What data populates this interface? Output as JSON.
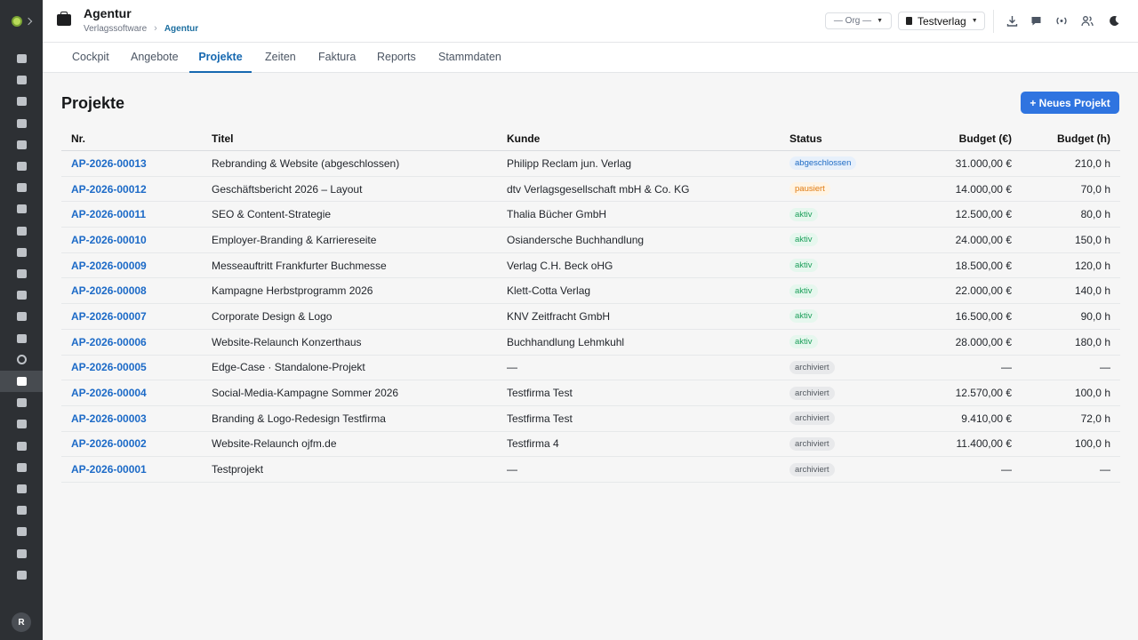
{
  "sidebar": {
    "avatar_initial": "R",
    "icons": [
      "dashboard-icon",
      "calendar-icon",
      "layout-icon",
      "user-edit-icon",
      "inbox-icon",
      "send-icon",
      "lightbulb-icon",
      "library-icon",
      "image-icon",
      "briefcase-icon",
      "newspaper-icon",
      "book-icon",
      "feather-icon",
      "tray-icon",
      "circle-icon",
      "agency-icon",
      "megaphone-icon",
      "film-icon",
      "music-icon",
      "file-icon",
      "store-icon",
      "chat-icon",
      "chart-icon",
      "document-icon",
      "shield-icon"
    ],
    "active_index": 15
  },
  "header": {
    "title": "Agentur",
    "breadcrumb": [
      "Verlagssoftware",
      "Agentur"
    ],
    "org_select": "— Org —",
    "publisher_select": "Testverlag",
    "icons": [
      "download-icon",
      "chat-icon",
      "broadcast-icon",
      "users-icon",
      "moon-icon"
    ]
  },
  "tabs": [
    {
      "label": "Cockpit"
    },
    {
      "label": "Angebote"
    },
    {
      "label": "Projekte",
      "active": true
    },
    {
      "label": "Zeiten"
    },
    {
      "label": "Faktura"
    },
    {
      "label": "Reports"
    },
    {
      "label": "Stammdaten"
    }
  ],
  "main": {
    "title": "Projekte",
    "new_button": "+ Neues Projekt",
    "columns": {
      "nr": "Nr.",
      "titel": "Titel",
      "kunde": "Kunde",
      "status": "Status",
      "budget": "Budget (€)",
      "hours": "Budget (h)"
    },
    "rows": [
      {
        "nr": "AP-2026-00013",
        "titel": "Rebranding & Website (abgeschlossen)",
        "kunde": "Philipp Reclam jun. Verlag",
        "status": "abgeschlossen",
        "budget": "31.000,00 €",
        "hours": "210,0 h"
      },
      {
        "nr": "AP-2026-00012",
        "titel": "Geschäftsbericht 2026 – Layout",
        "kunde": "dtv Verlagsgesellschaft mbH & Co. KG",
        "status": "pausiert",
        "budget": "14.000,00 €",
        "hours": "70,0 h"
      },
      {
        "nr": "AP-2026-00011",
        "titel": "SEO & Content-Strategie",
        "kunde": "Thalia Bücher GmbH",
        "status": "aktiv",
        "budget": "12.500,00 €",
        "hours": "80,0 h"
      },
      {
        "nr": "AP-2026-00010",
        "titel": "Employer-Branding & Karriereseite",
        "kunde": "Osiandersche Buchhandlung",
        "status": "aktiv",
        "budget": "24.000,00 €",
        "hours": "150,0 h"
      },
      {
        "nr": "AP-2026-00009",
        "titel": "Messeauftritt Frankfurter Buchmesse",
        "kunde": "Verlag C.H. Beck oHG",
        "status": "aktiv",
        "budget": "18.500,00 €",
        "hours": "120,0 h"
      },
      {
        "nr": "AP-2026-00008",
        "titel": "Kampagne Herbstprogramm 2026",
        "kunde": "Klett-Cotta Verlag",
        "status": "aktiv",
        "budget": "22.000,00 €",
        "hours": "140,0 h"
      },
      {
        "nr": "AP-2026-00007",
        "titel": "Corporate Design & Logo",
        "kunde": "KNV Zeitfracht GmbH",
        "status": "aktiv",
        "budget": "16.500,00 €",
        "hours": "90,0 h"
      },
      {
        "nr": "AP-2026-00006",
        "titel": "Website-Relaunch Konzerthaus",
        "kunde": "Buchhandlung Lehmkuhl",
        "status": "aktiv",
        "budget": "28.000,00 €",
        "hours": "180,0 h"
      },
      {
        "nr": "AP-2026-00005",
        "titel": "Edge-Case · Standalone-Projekt",
        "kunde": "—",
        "status": "archiviert",
        "budget": "—",
        "hours": "—"
      },
      {
        "nr": "AP-2026-00004",
        "titel": "Social-Media-Kampagne Sommer 2026",
        "kunde": "Testfirma Test",
        "status": "archiviert",
        "budget": "12.570,00 €",
        "hours": "100,0 h"
      },
      {
        "nr": "AP-2026-00003",
        "titel": "Branding & Logo-Redesign Testfirma",
        "kunde": "Testfirma Test",
        "status": "archiviert",
        "budget": "9.410,00 €",
        "hours": "72,0 h"
      },
      {
        "nr": "AP-2026-00002",
        "titel": "Website-Relaunch ojfm.de",
        "kunde": "Testfirma 4",
        "status": "archiviert",
        "budget": "11.400,00 €",
        "hours": "100,0 h"
      },
      {
        "nr": "AP-2026-00001",
        "titel": "Testprojekt",
        "kunde": "—",
        "status": "archiviert",
        "budget": "—",
        "hours": "—"
      }
    ]
  },
  "colors": {
    "sidebar_bg": "#2d3034",
    "accent": "#2f74e0",
    "link": "#1c6ac7",
    "status_aktiv": "#1c9f5a",
    "status_pausiert": "#e07a10",
    "status_abgeschlossen": "#1e6bc4",
    "status_archiviert": "#555b62"
  }
}
